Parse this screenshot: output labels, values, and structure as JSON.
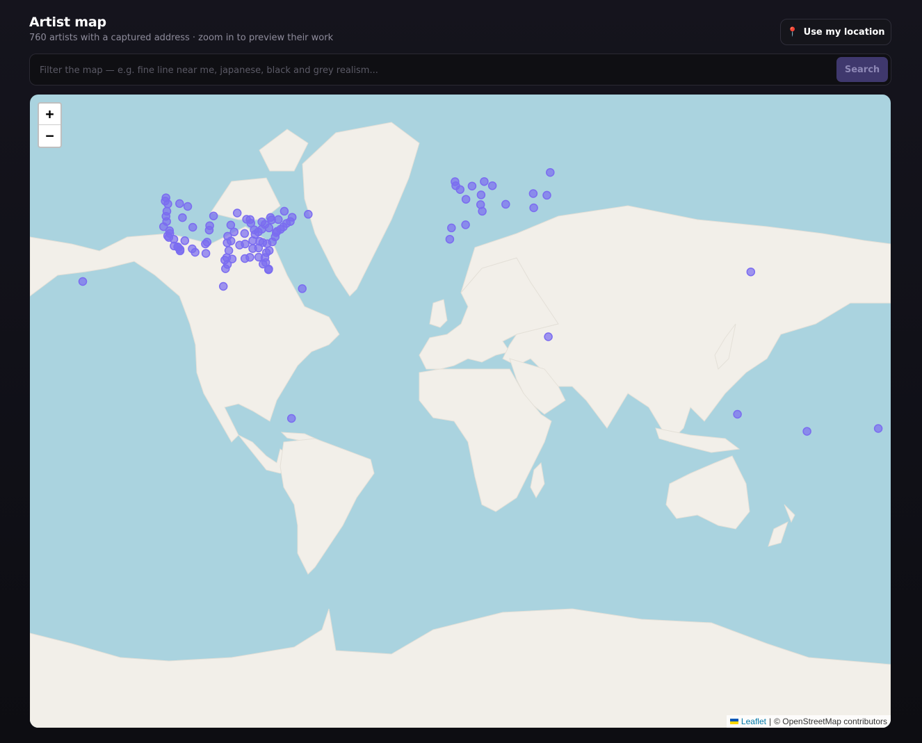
{
  "header": {
    "title": "Artist map",
    "subtitle": "760 artists with a captured address · zoom in to preview their work",
    "location_button": "Use my location",
    "location_icon": "map-pin-icon"
  },
  "search": {
    "placeholder": "Filter the map — e.g. fine line near me, japanese, black and grey realism...",
    "value": "",
    "button_label": "Search"
  },
  "map": {
    "zoom_in_label": "+",
    "zoom_out_label": "−",
    "attribution_link": "Leaflet",
    "attribution_separator": "|",
    "attribution_text": "© OpenStreetMap contributors",
    "marker_color": "#7b6cf0",
    "water_color": "#aad3df",
    "land_color": "#f2efe9",
    "markers": [
      {
        "lat": 47.6,
        "lng": -122.3
      },
      {
        "lat": 45.5,
        "lng": -122.7
      },
      {
        "lat": 44.0,
        "lng": -123.1
      },
      {
        "lat": 42.4,
        "lng": -122.8
      },
      {
        "lat": 40.8,
        "lng": -124.1
      },
      {
        "lat": 39.5,
        "lng": -121.6
      },
      {
        "lat": 38.6,
        "lng": -121.5
      },
      {
        "lat": 37.8,
        "lng": -122.4
      },
      {
        "lat": 37.3,
        "lng": -121.9
      },
      {
        "lat": 36.7,
        "lng": -119.8
      },
      {
        "lat": 34.4,
        "lng": -119.7
      },
      {
        "lat": 34.1,
        "lng": -118.2
      },
      {
        "lat": 33.8,
        "lng": -117.9
      },
      {
        "lat": 33.2,
        "lng": -117.2
      },
      {
        "lat": 32.7,
        "lng": -117.2
      },
      {
        "lat": 36.2,
        "lng": -115.2
      },
      {
        "lat": 33.4,
        "lng": -112.1
      },
      {
        "lat": 32.2,
        "lng": -110.9
      },
      {
        "lat": 35.1,
        "lng": -106.6
      },
      {
        "lat": 35.7,
        "lng": -105.9
      },
      {
        "lat": 39.7,
        "lng": -105.0
      },
      {
        "lat": 40.6,
        "lng": -111.9
      },
      {
        "lat": 43.6,
        "lng": -116.2
      },
      {
        "lat": 47.7,
        "lng": -117.4
      },
      {
        "lat": 46.9,
        "lng": -114.0
      },
      {
        "lat": 41.1,
        "lng": -104.8
      },
      {
        "lat": 44.1,
        "lng": -103.2
      },
      {
        "lat": 41.3,
        "lng": -96.0
      },
      {
        "lat": 39.1,
        "lng": -94.6
      },
      {
        "lat": 37.7,
        "lng": -97.3
      },
      {
        "lat": 35.5,
        "lng": -97.5
      },
      {
        "lat": 32.8,
        "lng": -96.8
      },
      {
        "lat": 30.3,
        "lng": -97.7
      },
      {
        "lat": 29.8,
        "lng": -95.4
      },
      {
        "lat": 29.4,
        "lng": -98.5
      },
      {
        "lat": 31.8,
        "lng": -106.4
      },
      {
        "lat": 44.98,
        "lng": -93.3
      },
      {
        "lat": 43.1,
        "lng": -89.4
      },
      {
        "lat": 43.0,
        "lng": -87.9
      },
      {
        "lat": 41.9,
        "lng": -87.6
      },
      {
        "lat": 42.3,
        "lng": -83.0
      },
      {
        "lat": 39.8,
        "lng": -86.2
      },
      {
        "lat": 39.1,
        "lng": -84.5
      },
      {
        "lat": 40.0,
        "lng": -83.0
      },
      {
        "lat": 41.5,
        "lng": -81.7
      },
      {
        "lat": 40.4,
        "lng": -80.0
      },
      {
        "lat": 38.6,
        "lng": -90.2
      },
      {
        "lat": 36.2,
        "lng": -86.8
      },
      {
        "lat": 35.1,
        "lng": -90.0
      },
      {
        "lat": 33.5,
        "lng": -86.8
      },
      {
        "lat": 33.7,
        "lng": -84.4
      },
      {
        "lat": 35.2,
        "lng": -80.8
      },
      {
        "lat": 35.8,
        "lng": -78.6
      },
      {
        "lat": 37.5,
        "lng": -77.4
      },
      {
        "lat": 38.9,
        "lng": -77.0
      },
      {
        "lat": 39.3,
        "lng": -76.6
      },
      {
        "lat": 39.95,
        "lng": -75.2
      },
      {
        "lat": 40.7,
        "lng": -74.0
      },
      {
        "lat": 41.8,
        "lng": -72.7
      },
      {
        "lat": 42.4,
        "lng": -71.1
      },
      {
        "lat": 43.7,
        "lng": -70.3
      },
      {
        "lat": 43.0,
        "lng": -76.1
      },
      {
        "lat": 42.9,
        "lng": -78.9
      },
      {
        "lat": 32.8,
        "lng": -79.9
      },
      {
        "lat": 32.1,
        "lng": -81.1
      },
      {
        "lat": 30.3,
        "lng": -81.7
      },
      {
        "lat": 28.5,
        "lng": -81.4
      },
      {
        "lat": 27.9,
        "lng": -82.5
      },
      {
        "lat": 25.8,
        "lng": -80.2
      },
      {
        "lat": 26.1,
        "lng": -80.1
      },
      {
        "lat": 29.95,
        "lng": -90.1
      },
      {
        "lat": 30.4,
        "lng": -88.0
      },
      {
        "lat": 30.45,
        "lng": -84.3
      },
      {
        "lat": 34.7,
        "lng": -92.3
      },
      {
        "lat": 36.1,
        "lng": -95.9
      },
      {
        "lat": 38.3,
        "lng": -85.8
      },
      {
        "lat": 36.0,
        "lng": -83.9
      },
      {
        "lat": 35.6,
        "lng": -82.6
      },
      {
        "lat": 27.8,
        "lng": -97.4
      },
      {
        "lat": 26.2,
        "lng": -98.2
      },
      {
        "lat": 43.65,
        "lng": -79.4
      },
      {
        "lat": 45.5,
        "lng": -73.6
      },
      {
        "lat": 44.6,
        "lng": -63.6
      },
      {
        "lat": 49.3,
        "lng": -123.1
      },
      {
        "lat": 48.4,
        "lng": -123.4
      },
      {
        "lat": 21.3,
        "lng": -157.9
      },
      {
        "lat": 19.4,
        "lng": -99.1
      },
      {
        "lat": 18.5,
        "lng": -66.1
      },
      {
        "lat": -33.4,
        "lng": -70.6
      },
      {
        "lat": 53.5,
        "lng": -2.2
      },
      {
        "lat": 52.5,
        "lng": -1.9
      },
      {
        "lat": 51.5,
        "lng": -0.1
      },
      {
        "lat": 52.4,
        "lng": 4.9
      },
      {
        "lat": 52.5,
        "lng": 13.4
      },
      {
        "lat": 53.55,
        "lng": 10.0
      },
      {
        "lat": 50.1,
        "lng": 8.7
      },
      {
        "lat": 48.9,
        "lng": 2.35
      },
      {
        "lat": 47.4,
        "lng": 8.5
      },
      {
        "lat": 45.5,
        "lng": 9.2
      },
      {
        "lat": 47.5,
        "lng": 19.0
      },
      {
        "lat": 41.4,
        "lng": 2.2
      },
      {
        "lat": 40.4,
        "lng": -3.7
      },
      {
        "lat": 36.7,
        "lng": -4.4
      },
      {
        "lat": 55.75,
        "lng": 37.6
      },
      {
        "lat": 50.45,
        "lng": 30.5
      },
      {
        "lat": 50.0,
        "lng": 36.2
      },
      {
        "lat": 46.5,
        "lng": 30.7
      },
      {
        "lat": 25.0,
        "lng": 121.5
      },
      {
        "lat": -1.3,
        "lng": 36.8
      },
      {
        "lat": -31.95,
        "lng": 115.9
      },
      {
        "lat": -37.8,
        "lng": 145.0
      },
      {
        "lat": -36.85,
        "lng": 174.8
      }
    ]
  }
}
